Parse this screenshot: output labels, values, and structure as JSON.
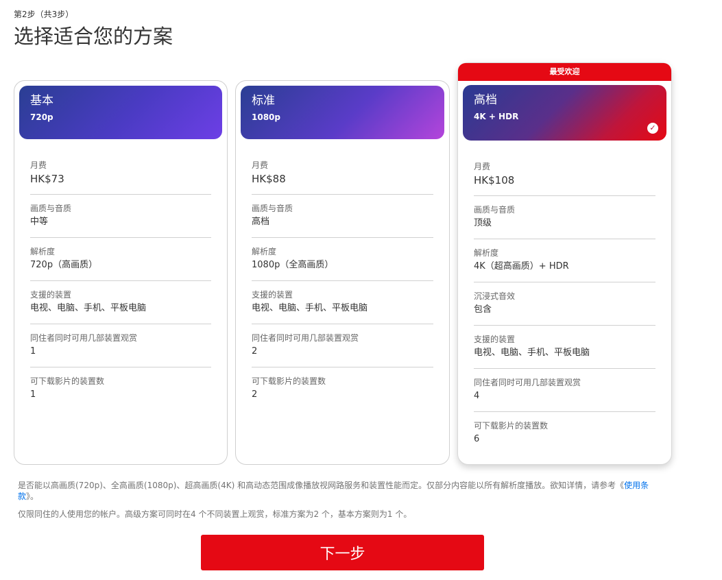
{
  "header": {
    "step": "第2步（共3步）",
    "title": "选择适合您的方案"
  },
  "plans": [
    {
      "name": "基本",
      "resolution_tag": "720p",
      "rows": [
        {
          "label": "月费",
          "value": "HK$73"
        },
        {
          "label": "画质与音质",
          "value": "中等"
        },
        {
          "label": "解析度",
          "value": "720p（高画质）"
        },
        {
          "label": "支援的装置",
          "value": "电视、电脑、手机、平板电脑"
        },
        {
          "label": "同住者同时可用几部装置观赏",
          "value": "1"
        },
        {
          "label": "可下载影片的装置数",
          "value": "1"
        }
      ]
    },
    {
      "name": "标准",
      "resolution_tag": "1080p",
      "rows": [
        {
          "label": "月费",
          "value": "HK$88"
        },
        {
          "label": "画质与音质",
          "value": "高档"
        },
        {
          "label": "解析度",
          "value": "1080p（全高画质）"
        },
        {
          "label": "支援的装置",
          "value": "电视、电脑、手机、平板电脑"
        },
        {
          "label": "同住者同时可用几部装置观赏",
          "value": "2"
        },
        {
          "label": "可下载影片的装置数",
          "value": "2"
        }
      ]
    },
    {
      "name": "高档",
      "resolution_tag": "4K + HDR",
      "badge": "最受欢迎",
      "selected": true,
      "check_icon": "check-circle-icon",
      "rows": [
        {
          "label": "月费",
          "value": "HK$108"
        },
        {
          "label": "画质与音质",
          "value": "顶级"
        },
        {
          "label": "解析度",
          "value": "4K（超高画质）+ HDR"
        },
        {
          "label": "沉浸式音效",
          "value": "包含"
        },
        {
          "label": "支援的装置",
          "value": "电视、电脑、手机、平板电脑"
        },
        {
          "label": "同住者同时可用几部装置观赏",
          "value": "4"
        },
        {
          "label": "可下载影片的装置数",
          "value": "6"
        }
      ]
    }
  ],
  "notes": {
    "note1_text": "是否能以高画质(720p)、全高画质(1080p)、超高画质(4K) 和高动态范围成像播放视网路服务和装置性能而定。仅部分内容能以所有解析度播放。欲知详情，请参考《",
    "note1_link": "使用条款",
    "note1_end": "》。",
    "note2": "仅限同住的人使用您的帐户。高级方案可同时在4 个不同装置上观赏，标准方案为2 个，基本方案则为1 个。"
  },
  "next_button": "下一步",
  "colors": {
    "brand_red": "#e50914",
    "link_blue": "#0071eb"
  }
}
